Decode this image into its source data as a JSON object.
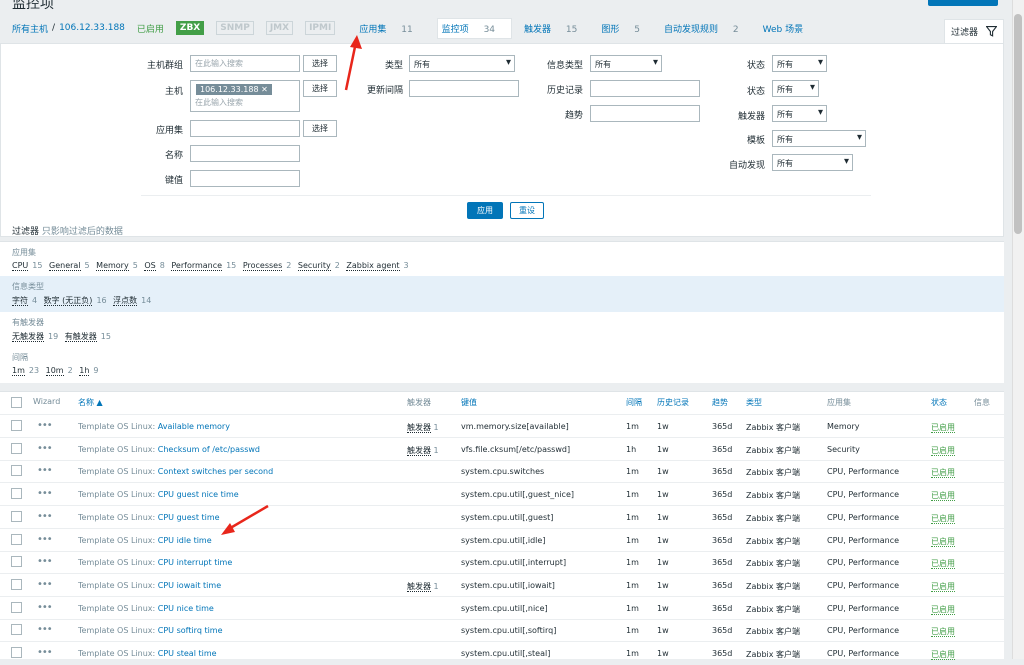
{
  "page_title": "监控项",
  "nav": {
    "all_hosts": "所有主机",
    "host": "106.12.33.188",
    "status": "已启用",
    "badges": [
      "ZBX",
      "SNMP",
      "JMX",
      "IPMI"
    ],
    "tabs": [
      {
        "label": "应用集",
        "count": "11"
      },
      {
        "label": "监控项",
        "count": "34"
      },
      {
        "label": "触发器",
        "count": "15"
      },
      {
        "label": "图形",
        "count": "5"
      },
      {
        "label": "自动发现规则",
        "count": "2"
      },
      {
        "label": "Web 场景",
        "count": ""
      }
    ],
    "filter_tab": "过滤器"
  },
  "filter": {
    "host_group_label": "主机群组",
    "host_group_placeholder": "在此输入搜索",
    "select": "选择",
    "host_label": "主机",
    "host_tag": "106.12.33.188",
    "host_placeholder": "在此输入搜索",
    "app_label": "应用集",
    "name_label": "名称",
    "key_label": "键值",
    "type_label": "类型",
    "type_value": "所有",
    "update_label": "更新间隔",
    "info_type_label": "信息类型",
    "info_type_value": "所有",
    "history_label": "历史记录",
    "trends_label": "趋势",
    "state_label": "状态",
    "state_value": "所有",
    "status_label": "状态",
    "status_value": "所有",
    "triggers_label": "触发器",
    "triggers_value": "所有",
    "template_label": "模板",
    "template_value": "所有",
    "discovery_label": "自动发现",
    "discovery_value": "所有",
    "apply": "应用",
    "reset": "重设"
  },
  "subfilter": {
    "title": "过滤器",
    "hint": "只影响过滤后的数据",
    "groups": [
      {
        "header": "应用集",
        "items": [
          [
            "CPU",
            "15"
          ],
          [
            "General",
            "5"
          ],
          [
            "Memory",
            "5"
          ],
          [
            "OS",
            "8"
          ],
          [
            "Performance",
            "15"
          ],
          [
            "Processes",
            "2"
          ],
          [
            "Security",
            "2"
          ],
          [
            "Zabbix agent",
            "3"
          ]
        ]
      },
      {
        "header": "信息类型",
        "items": [
          [
            "字符",
            "4"
          ],
          [
            "数字 (无正负)",
            "16"
          ],
          [
            "浮点数",
            "14"
          ]
        ]
      },
      {
        "header": "有触发器",
        "items": [
          [
            "无触发器",
            "19"
          ],
          [
            "有触发器",
            "15"
          ]
        ]
      },
      {
        "header": "间隔",
        "items": [
          [
            "1m",
            "23"
          ],
          [
            "10m",
            "2"
          ],
          [
            "1h",
            "9"
          ]
        ]
      }
    ]
  },
  "table": {
    "headers": {
      "wizard": "Wizard",
      "name": "名称 ▲",
      "triggers": "触发器",
      "key": "键值",
      "interval": "间隔",
      "history": "历史记录",
      "trends": "趋势",
      "type": "类型",
      "apps": "应用集",
      "status": "状态",
      "info": "信息"
    },
    "rows": [
      {
        "tmpl": "Template OS Linux:",
        "name": "Available memory",
        "trig": "触发器",
        "tc": "1",
        "key": "vm.memory.size[available]",
        "int": "1m",
        "hist": "1w",
        "trend": "365d",
        "type": "Zabbix 客户端",
        "apps": "Memory",
        "status": "已启用"
      },
      {
        "tmpl": "Template OS Linux:",
        "name": "Checksum of /etc/passwd",
        "trig": "触发器",
        "tc": "1",
        "key": "vfs.file.cksum[/etc/passwd]",
        "int": "1h",
        "hist": "1w",
        "trend": "365d",
        "type": "Zabbix 客户端",
        "apps": "Security",
        "status": "已启用"
      },
      {
        "tmpl": "Template OS Linux:",
        "name": "Context switches per second",
        "trig": "",
        "tc": "",
        "key": "system.cpu.switches",
        "int": "1m",
        "hist": "1w",
        "trend": "365d",
        "type": "Zabbix 客户端",
        "apps": "CPU, Performance",
        "status": "已启用"
      },
      {
        "tmpl": "Template OS Linux:",
        "name": "CPU guest nice time",
        "trig": "",
        "tc": "",
        "key": "system.cpu.util[,guest_nice]",
        "int": "1m",
        "hist": "1w",
        "trend": "365d",
        "type": "Zabbix 客户端",
        "apps": "CPU, Performance",
        "status": "已启用"
      },
      {
        "tmpl": "Template OS Linux:",
        "name": "CPU guest time",
        "trig": "",
        "tc": "",
        "key": "system.cpu.util[,guest]",
        "int": "1m",
        "hist": "1w",
        "trend": "365d",
        "type": "Zabbix 客户端",
        "apps": "CPU, Performance",
        "status": "已启用"
      },
      {
        "tmpl": "Template OS Linux:",
        "name": "CPU idle time",
        "trig": "",
        "tc": "",
        "key": "system.cpu.util[,idle]",
        "int": "1m",
        "hist": "1w",
        "trend": "365d",
        "type": "Zabbix 客户端",
        "apps": "CPU, Performance",
        "status": "已启用"
      },
      {
        "tmpl": "Template OS Linux:",
        "name": "CPU interrupt time",
        "trig": "",
        "tc": "",
        "key": "system.cpu.util[,interrupt]",
        "int": "1m",
        "hist": "1w",
        "trend": "365d",
        "type": "Zabbix 客户端",
        "apps": "CPU, Performance",
        "status": "已启用"
      },
      {
        "tmpl": "Template OS Linux:",
        "name": "CPU iowait time",
        "trig": "触发器",
        "tc": "1",
        "key": "system.cpu.util[,iowait]",
        "int": "1m",
        "hist": "1w",
        "trend": "365d",
        "type": "Zabbix 客户端",
        "apps": "CPU, Performance",
        "status": "已启用"
      },
      {
        "tmpl": "Template OS Linux:",
        "name": "CPU nice time",
        "trig": "",
        "tc": "",
        "key": "system.cpu.util[,nice]",
        "int": "1m",
        "hist": "1w",
        "trend": "365d",
        "type": "Zabbix 客户端",
        "apps": "CPU, Performance",
        "status": "已启用"
      },
      {
        "tmpl": "Template OS Linux:",
        "name": "CPU softirq time",
        "trig": "",
        "tc": "",
        "key": "system.cpu.util[,softirq]",
        "int": "1m",
        "hist": "1w",
        "trend": "365d",
        "type": "Zabbix 客户端",
        "apps": "CPU, Performance",
        "status": "已启用"
      },
      {
        "tmpl": "Template OS Linux:",
        "name": "CPU steal time",
        "trig": "",
        "tc": "",
        "key": "system.cpu.util[,steal]",
        "int": "1m",
        "hist": "1w",
        "trend": "365d",
        "type": "Zabbix 客户端",
        "apps": "CPU, Performance",
        "status": "已启用"
      }
    ]
  },
  "colors": {
    "accent": "#0275b8",
    "enabled": "#429e47",
    "annotation": "#e8261b"
  }
}
